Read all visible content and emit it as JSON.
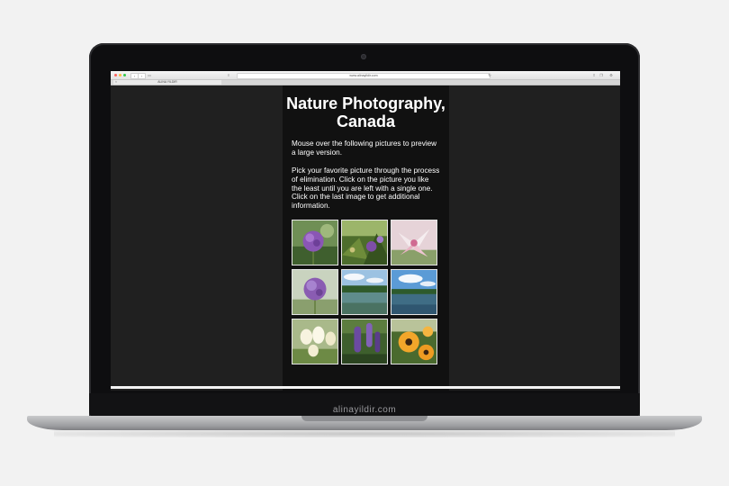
{
  "browser": {
    "url": "www.alinayildir.com",
    "tab_title": "ALINA YILDIR",
    "back": "‹",
    "forward": "›"
  },
  "page": {
    "title": "Nature Photography, Canada",
    "intro": "Mouse over the following pictures to preview a large version.",
    "instructions": "Pick your favorite picture through the process of elimination. Click on the picture you like the least until you are left with a single one. Click on the last image to get additional information."
  },
  "gallery": {
    "thumbnails": [
      {
        "subject": "purple allium flower"
      },
      {
        "subject": "purple wildflowers among greenery"
      },
      {
        "subject": "pink and white lily"
      },
      {
        "subject": "purple allium bloom"
      },
      {
        "subject": "lake with forest shoreline"
      },
      {
        "subject": "lake under blue sky with clouds"
      },
      {
        "subject": "white tulips"
      },
      {
        "subject": "purple lupine flowers"
      },
      {
        "subject": "orange black-eyed susan flowers"
      }
    ]
  },
  "watermark": "alinayildir.com",
  "colors": {
    "screen_background": "#202020",
    "column_background": "#111111",
    "text": "#ffffff"
  }
}
